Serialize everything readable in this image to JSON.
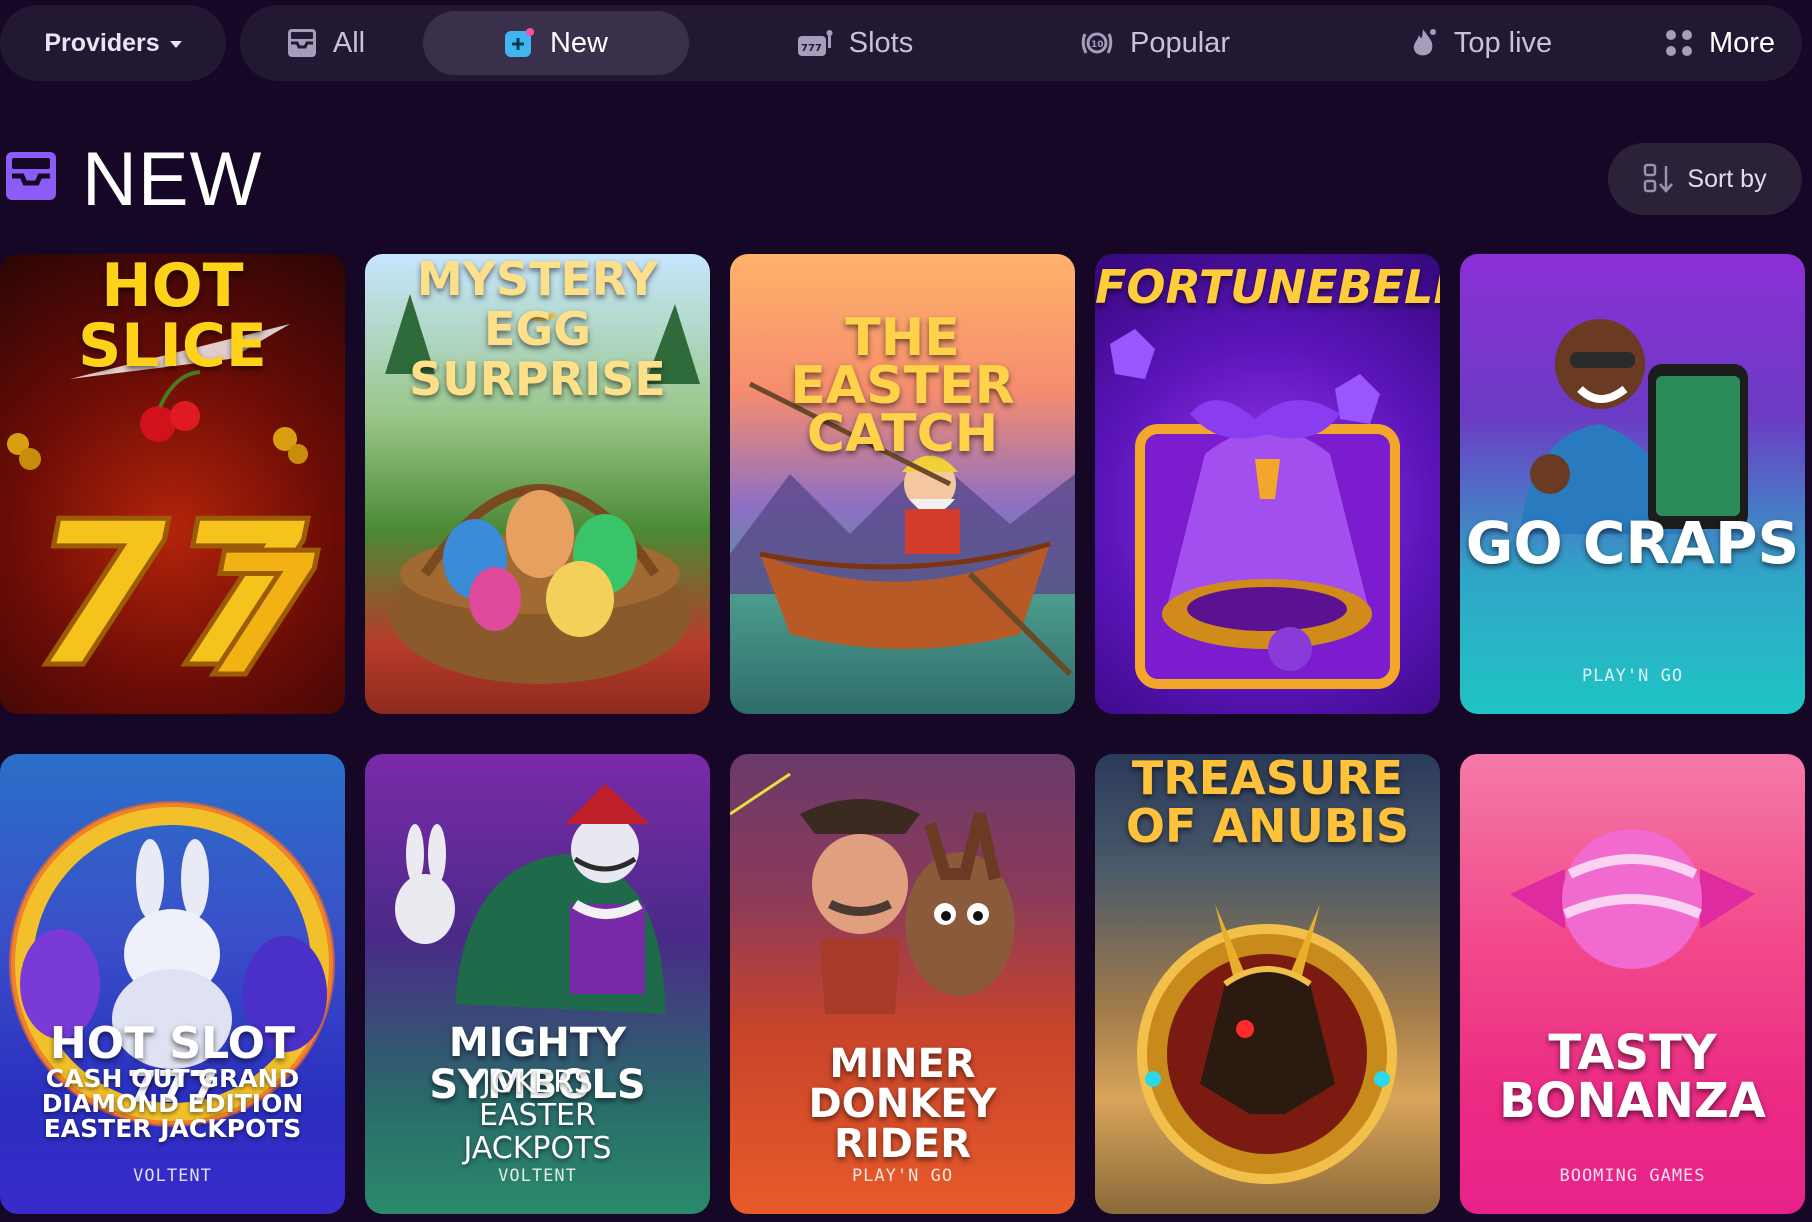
{
  "nav": {
    "providers_label": "Providers",
    "tabs": [
      {
        "label": "All",
        "icon": "inbox-icon"
      },
      {
        "label": "New",
        "icon": "new-plus-icon"
      },
      {
        "label": "Slots",
        "icon": "slot-machine-icon"
      },
      {
        "label": "Popular",
        "icon": "laurel-badge-icon"
      },
      {
        "label": "Top live",
        "icon": "flame-icon"
      },
      {
        "label": "More",
        "icon": "grid-dots-icon"
      }
    ],
    "active_tab": "New"
  },
  "section": {
    "title": "NEW",
    "icon": "inbox-icon",
    "sort_label": "Sort by"
  },
  "games": [
    {
      "logo": "HOT Slice",
      "title": "",
      "subtitle": "",
      "provider": ""
    },
    {
      "logo": "MYSTERY EGG SURPRISE",
      "title": "",
      "subtitle": "",
      "provider": ""
    },
    {
      "logo": "THE EASTER CATCH",
      "title": "",
      "subtitle": "",
      "provider": ""
    },
    {
      "logo": "FortuneBells",
      "title": "",
      "subtitle": "",
      "provider": ""
    },
    {
      "logo": "",
      "title": "GO CRAPS",
      "subtitle": "",
      "provider": "PLAY'N GO"
    },
    {
      "logo": "",
      "title": "HOT SLOT 777",
      "subtitle": "CASH OUT GRAND DIAMOND EDITION EASTER JACKPOTS",
      "provider": "VOLTENT"
    },
    {
      "logo": "",
      "title": "MIGHTY SYMBOLS",
      "subtitle": "JOKERS EASTER JACKPOTS",
      "provider": "VOLTENT"
    },
    {
      "logo": "",
      "title": "MINER DONKEY RIDER",
      "subtitle": "",
      "provider": "PLAY'N GO"
    },
    {
      "logo": "TREASURE OF ANUBIS",
      "title": "",
      "subtitle": "",
      "provider": ""
    },
    {
      "logo": "",
      "title": "TASTY BONANZA",
      "subtitle": "",
      "provider": "BOOMING GAMES"
    }
  ],
  "colors": {
    "background": "#150725",
    "nav_bg": "#221833",
    "active_tab_bg": "#3a304c",
    "accent_purple": "#8b5cf6",
    "accent_blue": "#3fb6f0"
  }
}
